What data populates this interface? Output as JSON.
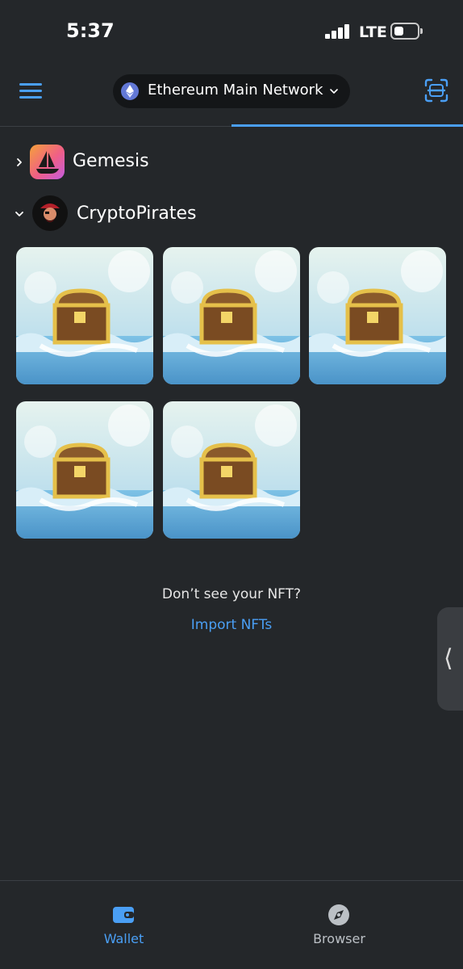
{
  "status_bar": {
    "time": "5:37",
    "network_type": "LTE",
    "signal_bars": 4,
    "battery_level_fraction": 0.3
  },
  "header": {
    "menu_icon": "hamburger-menu-icon",
    "network": {
      "label": "Ethereum Main Network",
      "icon": "ethereum-icon"
    },
    "scan_icon": "qr-scan-icon"
  },
  "collections": [
    {
      "name": "Gemesis",
      "expanded": false,
      "icon": "opensea-ship-icon"
    },
    {
      "name": "CryptoPirates",
      "expanded": true,
      "icon": "pirate-icon",
      "items": [
        {
          "image": "treasure-chest-in-waves"
        },
        {
          "image": "treasure-chest-in-waves"
        },
        {
          "image": "treasure-chest-in-waves"
        },
        {
          "image": "treasure-chest-in-waves"
        },
        {
          "image": "treasure-chest-in-waves"
        }
      ]
    }
  ],
  "empty_prompt": "Don’t see your NFT?",
  "import_link": "Import NFTs",
  "side_handle_icon": "chevron-left-icon",
  "bottom_nav": [
    {
      "label": "Wallet",
      "icon": "wallet-icon",
      "active": true
    },
    {
      "label": "Browser",
      "icon": "compass-icon",
      "active": false
    }
  ],
  "colors": {
    "background": "#24272a",
    "accent": "#4a9ff5",
    "pill": "#141618",
    "inactive": "#bbc0c5"
  }
}
